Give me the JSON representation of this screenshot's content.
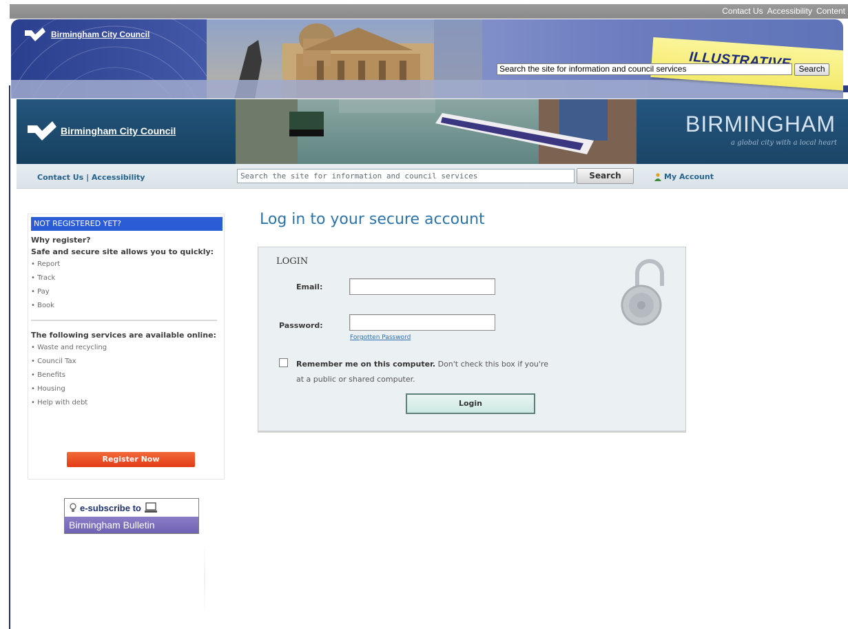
{
  "overlay": {
    "toplinks": [
      "Contact Us",
      "Accessibility",
      "Content"
    ],
    "logo_text": "Birmingham City Council",
    "search_placeholder": "Search the site for information and council services",
    "search_button": "Search",
    "note": "ILLUSTRATIVE"
  },
  "header": {
    "logo_text": "Birmingham City Council",
    "brand_name": "BIRMINGHAM",
    "brand_tagline": "a global city with a local heart"
  },
  "nav": {
    "contact": "Contact Us",
    "separator": " | ",
    "accessibility": "Accessibility",
    "search_placeholder": "Search the site for information and council services",
    "search_button": "Search",
    "my_account": "My Account"
  },
  "sidebar": {
    "heading": "NOT REGISTERED YET?",
    "why_register": "Why register?",
    "intro": "Safe and secure site allows you to quickly:",
    "actions": [
      "• Report",
      "• Track",
      "• Pay",
      "• Book"
    ],
    "services_title": "The following services are available online:",
    "services": [
      "• Waste and recycling",
      "• Council Tax",
      "• Benefits",
      "• Housing",
      "• Help with debt"
    ],
    "register_button": "Register Now",
    "esubscribe_top": "e-subscribe to",
    "esubscribe_bottom": "Birmingham Bulletin"
  },
  "main": {
    "title": "Log in to your secure account",
    "panel_label": "LOGIN",
    "email_label": "Email:",
    "email_value": "",
    "password_label": "Password:",
    "password_value": "",
    "forgotten_password": "Forgotten Password",
    "remember_bold": "Remember me on this computer.",
    "remember_rest": " Don't check this box if you're at a public or shared computer.",
    "login_button": "Login"
  },
  "colors": {
    "link": "#2c73a8",
    "header_blue": "#1b4566",
    "sidebar_heading": "#2c5bd6",
    "register_button": "#e23b15"
  }
}
